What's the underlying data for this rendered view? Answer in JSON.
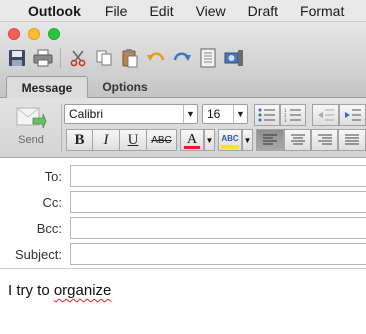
{
  "menubar": {
    "app_name": "Outlook",
    "items": [
      "File",
      "Edit",
      "View",
      "Draft",
      "Format"
    ]
  },
  "ribbon": {
    "tabs": [
      {
        "label": "Message",
        "active": true
      },
      {
        "label": "Options",
        "active": false
      }
    ],
    "send_label": "Send",
    "font_name": "Calibri",
    "font_size": "16",
    "format_buttons": [
      "B",
      "I",
      "U",
      "ABC"
    ],
    "font_color_letter": "A",
    "highlight_label": "ABC",
    "font_color": "#e02020",
    "highlight_color": "#f5e51a"
  },
  "header_fields": [
    {
      "label": "To:",
      "value": ""
    },
    {
      "label": "Cc:",
      "value": ""
    },
    {
      "label": "Bcc:",
      "value": ""
    },
    {
      "label": "Subject:",
      "value": ""
    }
  ],
  "body": {
    "text_before": "I try to ",
    "misspelled_word": "organize"
  }
}
